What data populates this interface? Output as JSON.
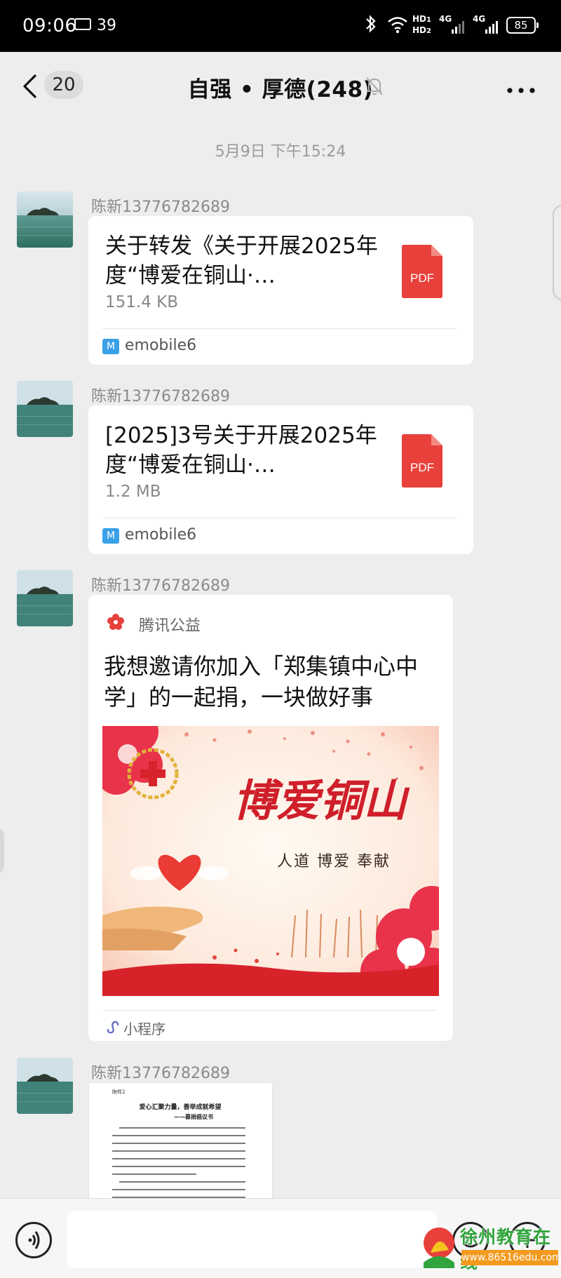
{
  "status_bar": {
    "time": "09:06",
    "notification_count": "39",
    "network_label": "HD1\nHD2",
    "sim1": "4G",
    "sim2": "4G",
    "battery": "85"
  },
  "nav": {
    "back_count": "20",
    "title": "自强 • 厚德(248)"
  },
  "timestamp": "5月9日 下午15:24",
  "messages": [
    {
      "sender": "陈新13776782689",
      "type": "file",
      "file_name": "关于转发《关于开展2025年度“博爱在铜山·…",
      "file_size": "151.4 KB",
      "file_type": "PDF",
      "app": "emobile6"
    },
    {
      "sender": "陈新13776782689",
      "type": "file",
      "file_name": "[2025]3号关于开展2025年度“博爱在铜山·…",
      "file_size": "1.2 MB",
      "file_type": "PDF",
      "app": "emobile6"
    },
    {
      "sender": "陈新13776782689",
      "type": "mini_program",
      "source": "腾讯公益",
      "headline": "我想邀请你加入「郑集镇中心中学」的一起捐，一块做好事",
      "cover_title": "博爱铜山",
      "cover_slogan": "人道 博爱 奉献",
      "tag": "小程序"
    },
    {
      "sender": "陈新13776782689",
      "type": "document_image",
      "doc_label": "附件2",
      "doc_title": "爱心汇聚力量，善举成就希望",
      "doc_subtitle": "——募捐倡议书"
    }
  ],
  "watermark": {
    "text": "徐州教育在线",
    "url": "www.86516edu.com"
  },
  "colors": {
    "pdf_red": "#e8403a",
    "app_blue": "#3aa0e8",
    "chat_bg": "#ededed"
  }
}
